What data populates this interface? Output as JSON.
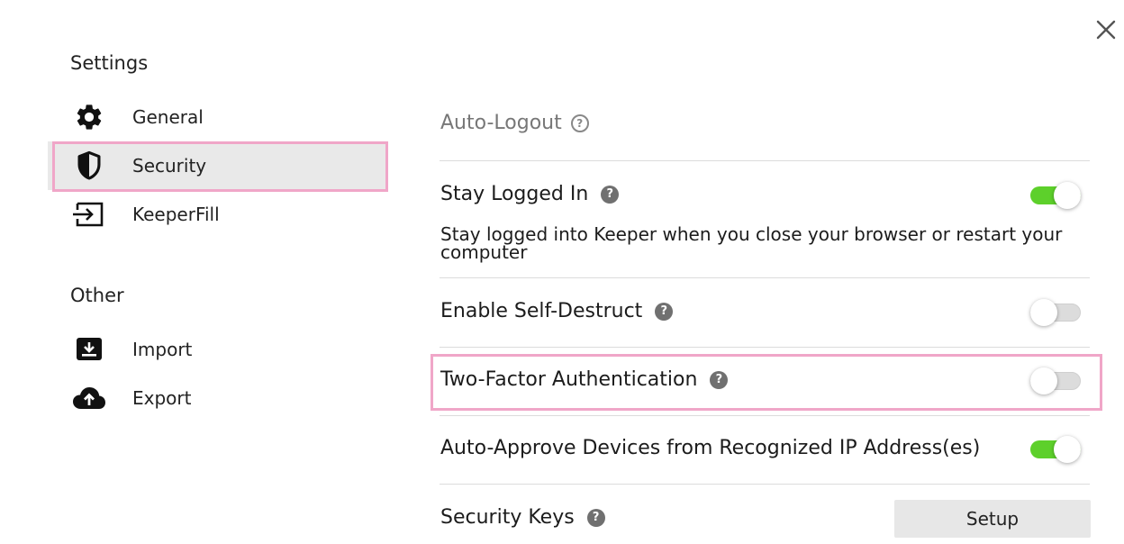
{
  "sidebar": {
    "settings_heading": "Settings",
    "settings_items": [
      {
        "label": "General",
        "icon": "gear-icon"
      },
      {
        "label": "Security",
        "icon": "shield-icon",
        "active": true
      },
      {
        "label": "KeeperFill",
        "icon": "keeperfill-icon"
      }
    ],
    "other_heading": "Other",
    "other_items": [
      {
        "label": "Import",
        "icon": "import-icon"
      },
      {
        "label": "Export",
        "icon": "cloud-upload-icon"
      }
    ]
  },
  "main": {
    "title": "Auto-Logout",
    "rows": [
      {
        "label": "Stay Logged In",
        "description": "Stay logged into Keeper when you close your browser or restart your computer",
        "enabled": true
      },
      {
        "label": "Enable Self-Destruct",
        "enabled": false
      },
      {
        "label": "Two-Factor Authentication",
        "enabled": false
      },
      {
        "label": "Auto-Approve Devices from Recognized IP Address(es)",
        "enabled": true
      },
      {
        "label": "Security Keys",
        "button_label": "Setup"
      }
    ]
  },
  "colors": {
    "toggle_on": "#5dd02b",
    "toggle_off": "#dcdcdc",
    "highlight": "#f0a6c8",
    "active_nav_bg": "#e9e9e9"
  }
}
